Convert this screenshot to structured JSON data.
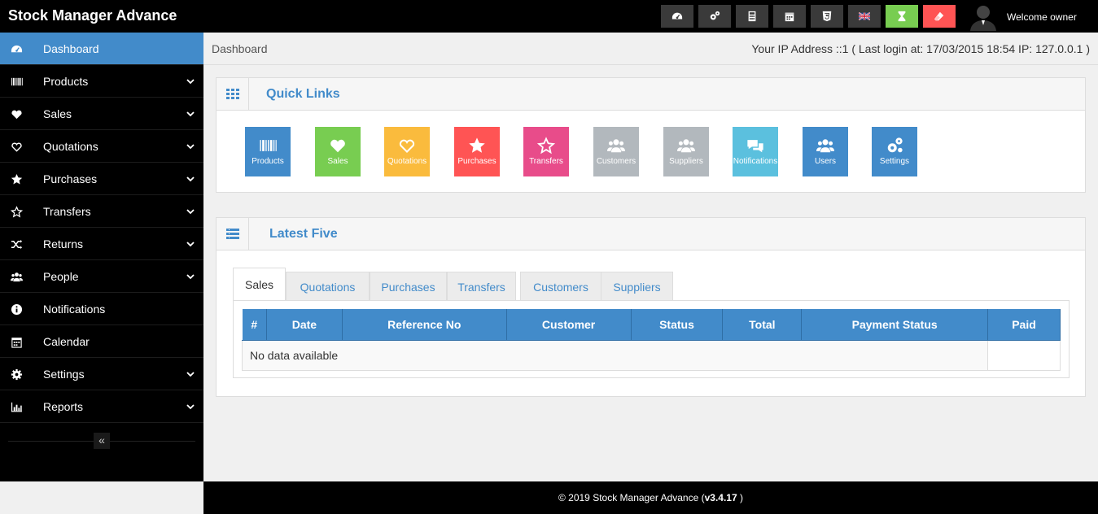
{
  "app": {
    "brand": "Stock Manager Advance",
    "welcome": "Welcome owner"
  },
  "top_buttons": [
    {
      "icon": "dashboard-icon",
      "color": "#3a3a3a"
    },
    {
      "icon": "gears-icon",
      "color": "#3a3a3a"
    },
    {
      "icon": "calculator-icon",
      "color": "#3a3a3a"
    },
    {
      "icon": "calendar-icon",
      "color": "#3a3a3a"
    },
    {
      "icon": "html5-icon",
      "color": "#3a3a3a"
    },
    {
      "icon": "uk-flag-icon",
      "color": "#3a3a3a"
    },
    {
      "icon": "hourglass-icon",
      "color": "#78cd51"
    },
    {
      "icon": "eraser-icon",
      "color": "#ff5454"
    }
  ],
  "sidebar": {
    "items": [
      {
        "label": "Dashboard",
        "icon": "dashboard-icon",
        "active": true,
        "has_children": false
      },
      {
        "label": "Products",
        "icon": "barcode-icon",
        "active": false,
        "has_children": true
      },
      {
        "label": "Sales",
        "icon": "heart-icon",
        "active": false,
        "has_children": true
      },
      {
        "label": "Quotations",
        "icon": "heart-outline-icon",
        "active": false,
        "has_children": true
      },
      {
        "label": "Purchases",
        "icon": "star-icon",
        "active": false,
        "has_children": true
      },
      {
        "label": "Transfers",
        "icon": "star-outline-icon",
        "active": false,
        "has_children": true
      },
      {
        "label": "Returns",
        "icon": "random-icon",
        "active": false,
        "has_children": true
      },
      {
        "label": "People",
        "icon": "users-icon",
        "active": false,
        "has_children": true
      },
      {
        "label": "Notifications",
        "icon": "info-icon",
        "active": false,
        "has_children": false
      },
      {
        "label": "Calendar",
        "icon": "calendar-icon",
        "active": false,
        "has_children": false
      },
      {
        "label": "Settings",
        "icon": "gear-icon",
        "active": false,
        "has_children": true
      },
      {
        "label": "Reports",
        "icon": "bar-chart-icon",
        "active": false,
        "has_children": true
      }
    ],
    "collapse_glyph": "«"
  },
  "header": {
    "breadcrumb": "Dashboard",
    "ip_info": "Your IP Address ::1 ( Last login at: 17/03/2015 18:54 IP: 127.0.0.1 )"
  },
  "quick_links": {
    "title": "Quick Links",
    "items": [
      {
        "label": "Products",
        "icon": "barcode-icon",
        "color": "#428bca"
      },
      {
        "label": "Sales",
        "icon": "heart-icon",
        "color": "#78cd51"
      },
      {
        "label": "Quotations",
        "icon": "heart-outline-icon",
        "color": "#fabb3d"
      },
      {
        "label": "Purchases",
        "icon": "star-icon",
        "color": "#ff5454"
      },
      {
        "label": "Transfers",
        "icon": "star-outline-icon",
        "color": "#e84c8a"
      },
      {
        "label": "Customers",
        "icon": "users-icon",
        "color": "#b2b8bd"
      },
      {
        "label": "Suppliers",
        "icon": "users-icon",
        "color": "#b2b8bd"
      },
      {
        "label": "Notifications",
        "icon": "comments-icon",
        "color": "#5bc0de"
      },
      {
        "label": "Users",
        "icon": "users-icon",
        "color": "#428bca"
      },
      {
        "label": "Settings",
        "icon": "gears-icon",
        "color": "#428bca"
      }
    ]
  },
  "latest_five": {
    "title": "Latest Five",
    "tabs": [
      "Sales",
      "Quotations",
      "Purchases",
      "Transfers",
      "Customers",
      "Suppliers"
    ],
    "active_tab": "Sales",
    "columns": [
      "#",
      "Date",
      "Reference No",
      "Customer",
      "Status",
      "Total",
      "Payment Status",
      "Paid"
    ],
    "empty_text": "No data available"
  },
  "footer": {
    "copyright": "© 2019 Stock Manager Advance (",
    "version": "v3.4.17",
    "close": " )"
  }
}
